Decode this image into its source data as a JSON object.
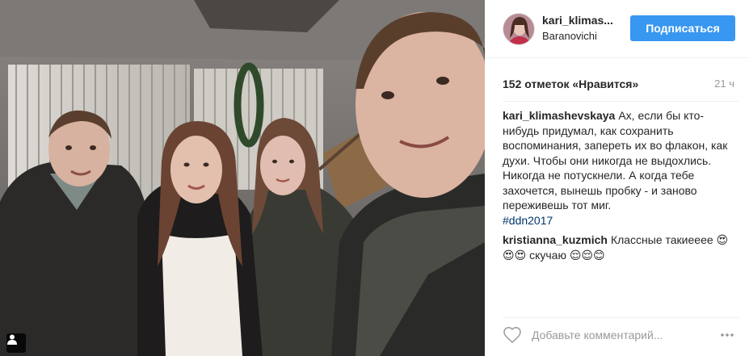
{
  "post": {
    "username": "kari_klimas...",
    "location": "Baranovichi",
    "follow_label": "Подписаться",
    "likes_text": "152 отметок «Нравится»",
    "time_ago": "21 ч"
  },
  "comments": [
    {
      "author": "kari_klimashevskaya",
      "text": "Ах, если бы кто-нибудь придумал, как сохранить воспоминания, запереть их во флакон, как духи. Чтобы они никогда не выдохлись. Никогда не потускнели. А когда тебе захочется, вынешь пробку - и заново переживешь тот миг.",
      "hashtag": "#ddn2017"
    },
    {
      "author": "kristianna_kuzmich",
      "text": "Классные такиееее 😍😍😍 скучаю 😌😌😊"
    }
  ],
  "footer": {
    "comment_placeholder": "Добавьте комментарий..."
  },
  "icons": {
    "heart": "heart-icon",
    "more": "more-options-icon",
    "user_tag": "user-tag-icon"
  },
  "colors": {
    "follow_button": "#3897f0",
    "hashtag": "#003569",
    "muted": "#999999"
  }
}
